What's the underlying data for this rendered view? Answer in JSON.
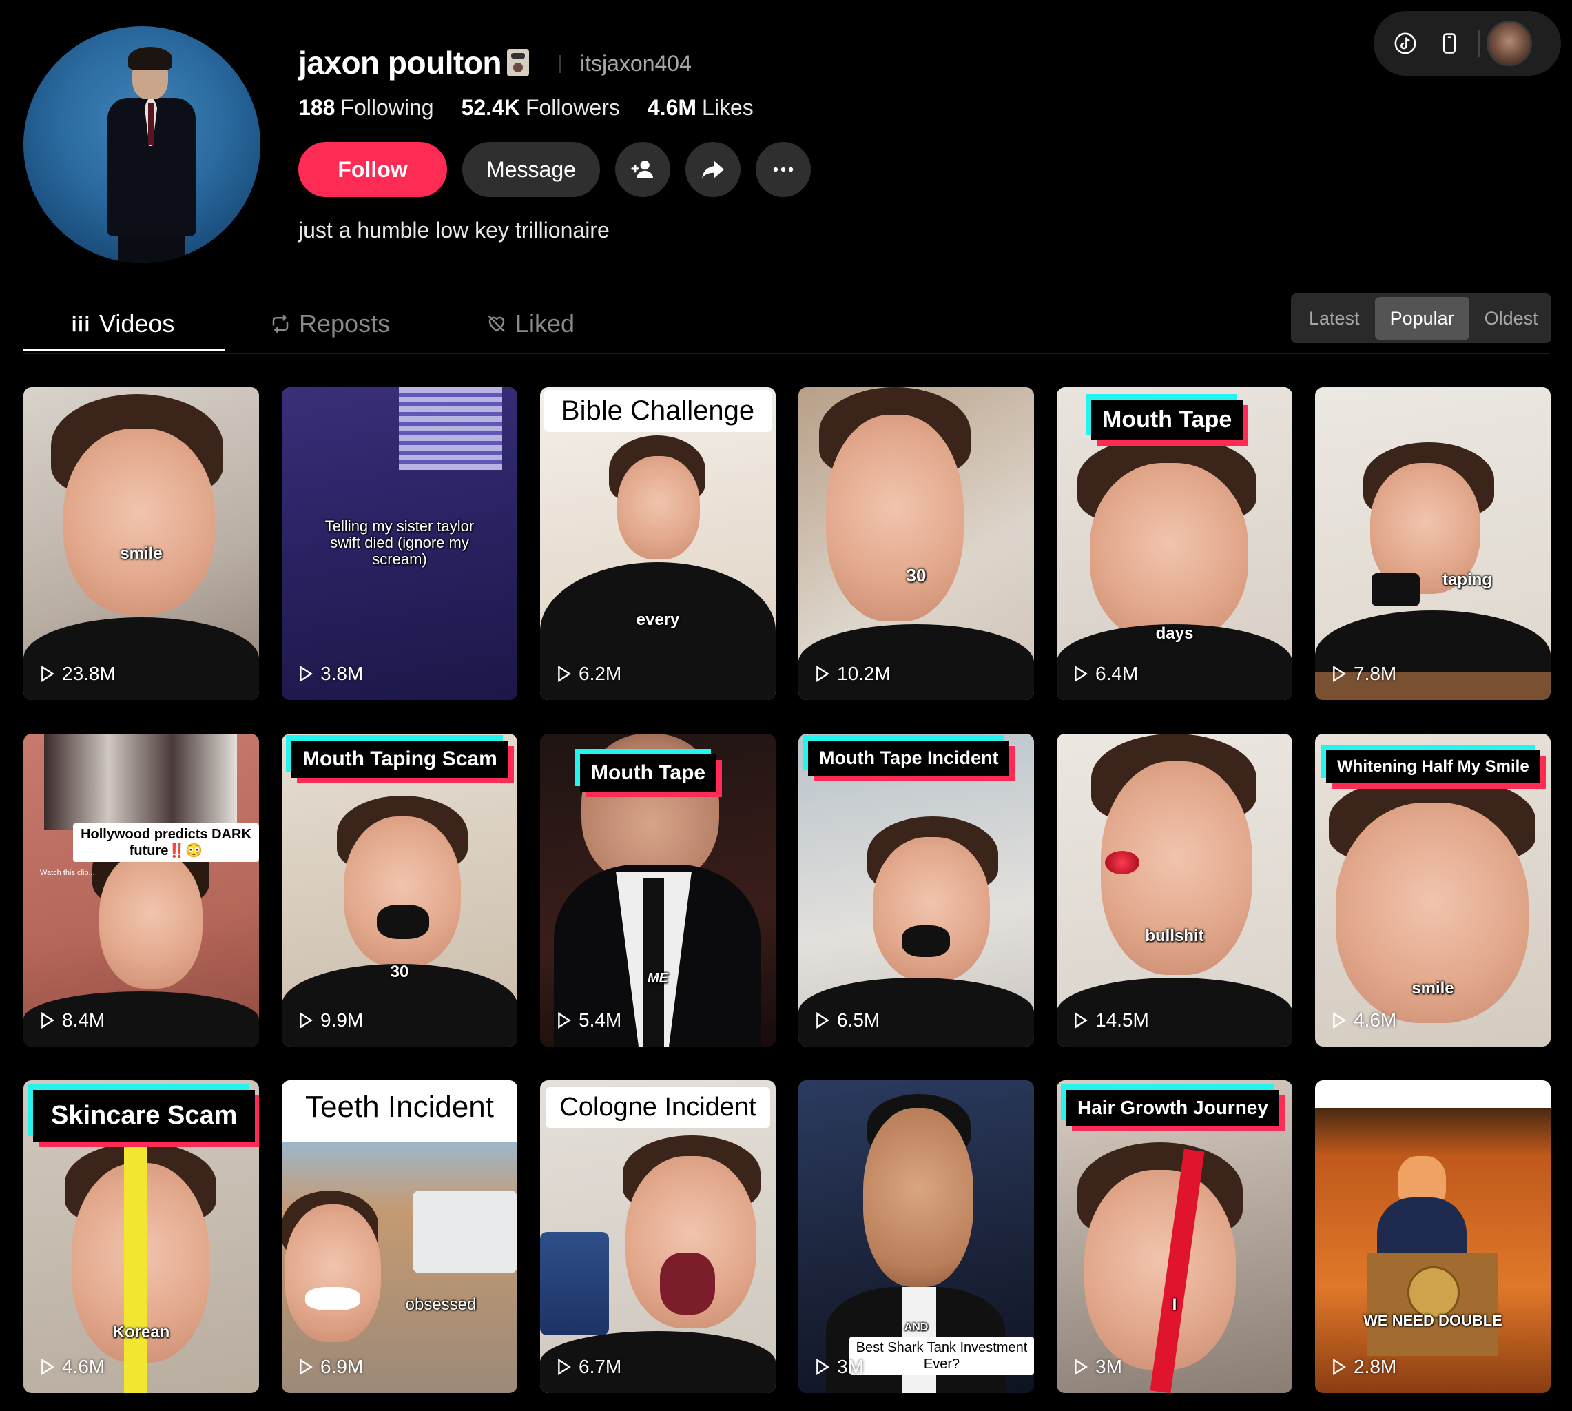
{
  "profile": {
    "username": "jaxon poulton",
    "handle": "itsjaxon404",
    "bio": "just a humble low key trillionaire",
    "stats": [
      {
        "value": "188",
        "label": "Following"
      },
      {
        "value": "52.4K",
        "label": "Followers"
      },
      {
        "value": "4.6M",
        "label": "Likes"
      }
    ],
    "buttons": {
      "follow": "Follow",
      "message": "Message"
    }
  },
  "tabs": [
    {
      "label": "Videos",
      "icon": "grid-icon"
    },
    {
      "label": "Reposts",
      "icon": "repost-icon"
    },
    {
      "label": "Liked",
      "icon": "heart-outline-icon"
    }
  ],
  "sort": {
    "options": [
      "Latest",
      "Popular",
      "Oldest"
    ],
    "selected": "Popular"
  },
  "colors": {
    "accent": "#fe2c55",
    "cyan": "#25f4ee",
    "background": "#000000"
  },
  "videos": [
    {
      "views": "23.8M",
      "caption": "smile"
    },
    {
      "views": "3.8M",
      "caption": "Telling my sister taylor swift died (ignore my scream)"
    },
    {
      "views": "6.2M",
      "title": "Bible Challenge",
      "caption": "every"
    },
    {
      "views": "10.2M",
      "caption": "30"
    },
    {
      "views": "6.4M",
      "title": "Mouth Tape",
      "caption": "days"
    },
    {
      "views": "7.8M",
      "caption": "taping"
    },
    {
      "views": "8.4M",
      "caption": "Hollywood predicts DARK future‼️😳",
      "subcaption": "Watch this clip..."
    },
    {
      "views": "9.9M",
      "title": "Mouth Taping Scam",
      "caption": "30"
    },
    {
      "views": "5.4M",
      "title": "Mouth Tape",
      "caption": "ME"
    },
    {
      "views": "6.5M",
      "title": "Mouth Tape Incident"
    },
    {
      "views": "14.5M",
      "caption": "bullshit"
    },
    {
      "views": "4.6M",
      "title": "Whitening Half My Smile",
      "caption": "smile"
    },
    {
      "views": "4.6M",
      "title": "Skincare Scam",
      "caption": "Korean"
    },
    {
      "views": "6.9M",
      "title": "Teeth Incident",
      "caption": "obsessed"
    },
    {
      "views": "6.7M",
      "title": "Cologne Incident"
    },
    {
      "views": "3M",
      "caption": "AND",
      "subcaption": "Best Shark Tank Investment Ever?"
    },
    {
      "views": "3M",
      "title": "Hair Growth Journey",
      "caption": "I"
    },
    {
      "views": "2.8M",
      "caption": "WE NEED DOUBLE"
    }
  ]
}
